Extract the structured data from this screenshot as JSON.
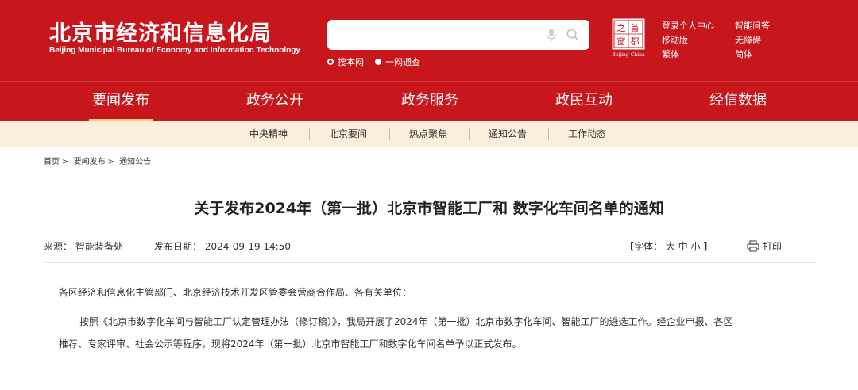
{
  "header": {
    "title": "北京市经济和信息化局",
    "subtitle": "Beijing Municipal Bureau of Economy and Information Technology",
    "search_placeholder": "",
    "scope_site": "搜本网",
    "scope_all": "一网通查",
    "seal_chars": [
      "首",
      "都",
      "之",
      "窗"
    ],
    "seal_caption": "Beijing-China",
    "quick_links": [
      "登录个人中心",
      "智能问答",
      "移动版",
      "无障碍",
      "繁体",
      "简体"
    ],
    "colors": {
      "brand_red": "#c8161d",
      "accent_gold": "#f3d37b",
      "subnav_bg": "#fbeedd"
    }
  },
  "nav": {
    "items": [
      "要闻发布",
      "政务公开",
      "政务服务",
      "政民互动",
      "经信数据"
    ],
    "active": "要闻发布"
  },
  "subnav": {
    "items": [
      "中央精神",
      "北京要闻",
      "热点聚焦",
      "通知公告",
      "工作动态"
    ]
  },
  "breadcrumb": {
    "items": [
      "首页",
      "要闻发布",
      "通知公告"
    ],
    "separator": ">"
  },
  "article": {
    "title": "关于发布2024年（第一批）北京市智能工厂和 数字化车间名单的通知",
    "source_label": "来源：",
    "source": "智能装备处",
    "date_label": "发布日期：",
    "date": "2024-09-19 14:50",
    "font_label": "【字体：",
    "font_sizes": [
      "大",
      "中",
      "小"
    ],
    "font_close": "】",
    "print_label": "打印",
    "paragraphs": [
      "各区经济和信息化主管部门、北京经济技术开发区管委会营商合作局、各有关单位：",
      "按照《北京市数字化车间与智能工厂认定管理办法（修订稿）》，我局开展了2024年（第一批）北京市数字化车间、智能工厂的遴选工作。经企业申报、各区",
      "推荐、专家评审、社会公示等程序，现将2024年（第一批）北京市智能工厂和数字化车间名单予以正式发布。"
    ]
  }
}
